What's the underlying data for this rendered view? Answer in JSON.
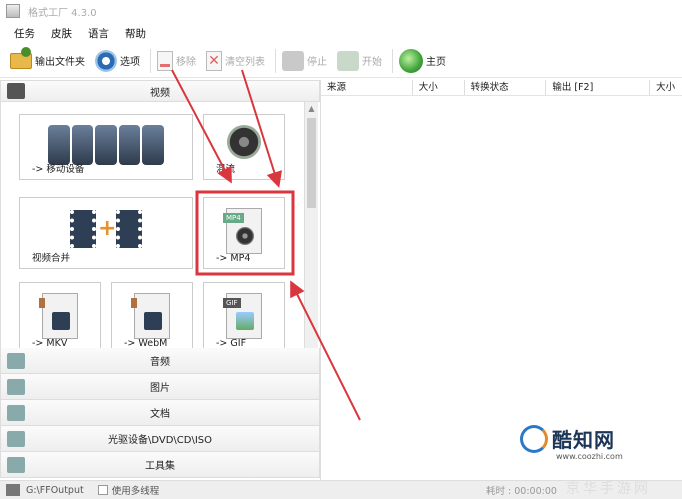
{
  "window": {
    "title": "格式工厂 4.3.0"
  },
  "menu": [
    "任务",
    "皮肤",
    "语言",
    "帮助"
  ],
  "toolbar": {
    "output_folder": "输出文件夹",
    "options": "选项",
    "remove": "移除",
    "clear_list": "清空列表",
    "stop": "停止",
    "start": "开始",
    "home": "主页"
  },
  "sidebar": {
    "video_header": "视频",
    "tiles": [
      {
        "label": "-> 移动设备",
        "icon": "mobile-devices-icon"
      },
      {
        "label": "混流",
        "icon": "mux-icon"
      },
      {
        "label": "视频合并",
        "icon": "video-merge-icon"
      },
      {
        "label": "-> MP4",
        "icon": "mp4-file-icon",
        "badge": "MP4"
      },
      {
        "label": "-> MKV",
        "icon": "mkv-file-icon"
      },
      {
        "label": "-> WebM",
        "icon": "webm-file-icon"
      },
      {
        "label": "-> GIF",
        "icon": "gif-file-icon",
        "badge": "GIF"
      }
    ],
    "categories": [
      "音频",
      "图片",
      "文档",
      "光驱设备\\DVD\\CD\\ISO",
      "工具集"
    ]
  },
  "task_table": {
    "columns": [
      "来源",
      "大小",
      "转换状态",
      "输出 [F2]",
      "大小"
    ]
  },
  "status": {
    "output_path": "G:\\FFOutput",
    "multithread": "使用多线程",
    "elapsed": "耗时 : 00:00:00"
  },
  "watermark": {
    "brand": "酷知网",
    "url": "www.coozhi.com",
    "secondary": "京华手游网"
  },
  "colors": {
    "highlight": "#d9363e",
    "accent": "#2b6bb4"
  }
}
